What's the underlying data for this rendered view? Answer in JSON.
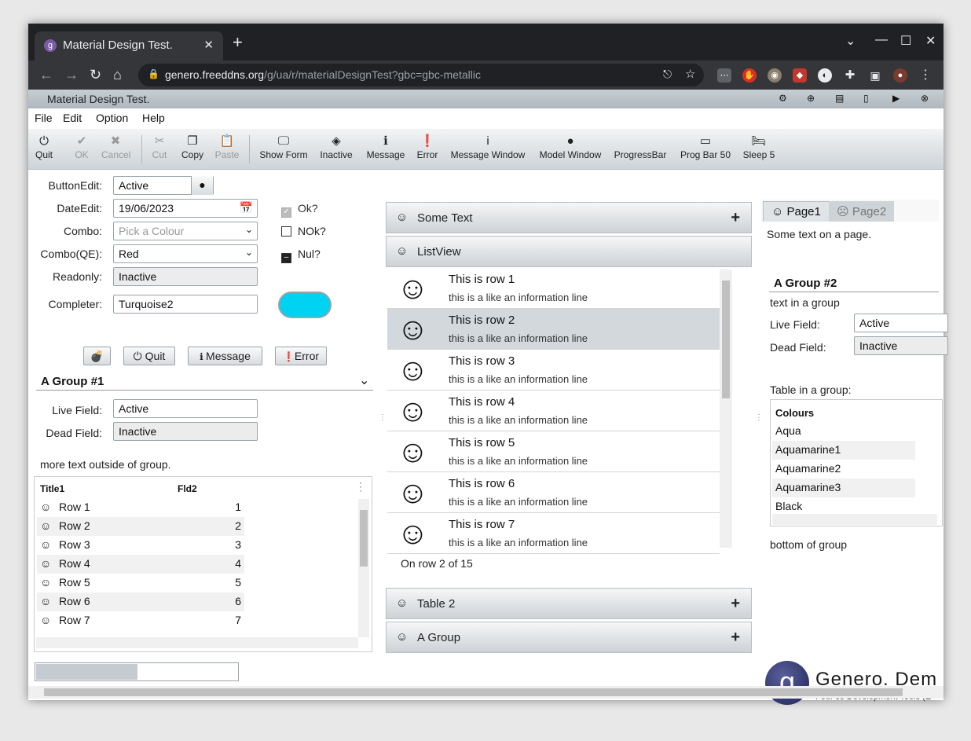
{
  "browser": {
    "tab_title": "Material Design Test.",
    "url_host": "genero.freeddns.org",
    "url_path": "/g/ua/r/materialDesignTest?gbc=gbc-metallic"
  },
  "app": {
    "title": "Material Design Test.",
    "menu": [
      "File",
      "Edit",
      "Option",
      "Help"
    ]
  },
  "toolbar": [
    {
      "label": "Quit",
      "icon": "⏻",
      "enabled": true
    },
    {
      "label": "OK",
      "icon": "✔",
      "enabled": false
    },
    {
      "label": "Cancel",
      "icon": "✖",
      "enabled": false
    },
    {
      "label": "Cut",
      "icon": "✂",
      "enabled": false
    },
    {
      "label": "Copy",
      "icon": "❐",
      "enabled": true
    },
    {
      "label": "Paste",
      "icon": "📋",
      "enabled": false
    },
    {
      "label": "Show Form",
      "icon": "🖵",
      "enabled": true
    },
    {
      "label": "Inactive",
      "icon": "◈",
      "enabled": true
    },
    {
      "label": "Message",
      "icon": "ℹ",
      "enabled": true
    },
    {
      "label": "Error",
      "icon": "❗",
      "enabled": true
    },
    {
      "label": "Message Window",
      "icon": "i",
      "enabled": true
    },
    {
      "label": "Model Window",
      "icon": "●",
      "enabled": true
    },
    {
      "label": "ProgressBar",
      "icon": "",
      "enabled": true
    },
    {
      "label": "Prog Bar 50",
      "icon": "▭",
      "enabled": true
    },
    {
      "label": "Sleep 5",
      "icon": "🛏",
      "enabled": true
    }
  ],
  "form": {
    "buttonedit_label": "ButtonEdit:",
    "buttonedit_value": "Active",
    "dateedit_label": "DateEdit:",
    "dateedit_value": "19/06/2023",
    "combo_label": "Combo:",
    "combo_placeholder": "Pick a Colour",
    "comboqe_label": "Combo(QE):",
    "comboqe_value": "Red",
    "readonly_label": "Readonly:",
    "readonly_value": "Inactive",
    "completer_label": "Completer:",
    "completer_value": "Turquoise2",
    "completer_color": "#00d2f2",
    "chk_ok": "Ok?",
    "chk_nok": "NOk?",
    "chk_nul": "Nul?",
    "btn_quit": "Quit",
    "btn_message": "Message",
    "btn_error": "Error"
  },
  "group1": {
    "title": "A Group #1",
    "live_label": "Live Field:",
    "live_value": "Active",
    "dead_label": "Dead Field:",
    "dead_value": "Inactive"
  },
  "more_text": "more text outside of group.",
  "table1": {
    "columns": [
      "Title1",
      "Fld2"
    ],
    "rows": [
      {
        "title": "Row 1",
        "fld": "1"
      },
      {
        "title": "Row 2",
        "fld": "2"
      },
      {
        "title": "Row 3",
        "fld": "3"
      },
      {
        "title": "Row 4",
        "fld": "4"
      },
      {
        "title": "Row 5",
        "fld": "5"
      },
      {
        "title": "Row 6",
        "fld": "6"
      },
      {
        "title": "Row 7",
        "fld": "7"
      }
    ],
    "progress": 0.5
  },
  "folders": {
    "some_text": "Some Text",
    "listview": "ListView",
    "table2": "Table 2",
    "a_group": "A Group"
  },
  "listview": {
    "rows": [
      {
        "a": "This is row 1",
        "b": "this is a like an information line"
      },
      {
        "a": "This is row 2",
        "b": "this is a like an information line"
      },
      {
        "a": "This is row 3",
        "b": "this is a like an information line"
      },
      {
        "a": "This is row 4",
        "b": "this is a like an information line"
      },
      {
        "a": "This is row 5",
        "b": "this is a like an information line"
      },
      {
        "a": "This is row 6",
        "b": "this is a like an information line"
      },
      {
        "a": "This is row 7",
        "b": "this is a like an information line"
      }
    ],
    "status": "On row 2 of 15"
  },
  "rightpanel": {
    "tab1": "Page1",
    "tab2": "Page2",
    "intro": "Some text on a page.",
    "group_title": "A Group #2",
    "group_text": "text in a group",
    "live_label": "Live Field:",
    "live_value": "Active",
    "dead_label": "Dead Field:",
    "dead_value": "Inactive",
    "table_label": "Table in a group:",
    "table_header": "Colours",
    "colours": [
      "Aqua",
      "Aquamarine1",
      "Aquamarine2",
      "Aquamarine3",
      "Black"
    ],
    "bottom": "bottom of group"
  },
  "logo": {
    "name": "Genero. Dem",
    "tagline": "Four Js Development Tools (E"
  }
}
